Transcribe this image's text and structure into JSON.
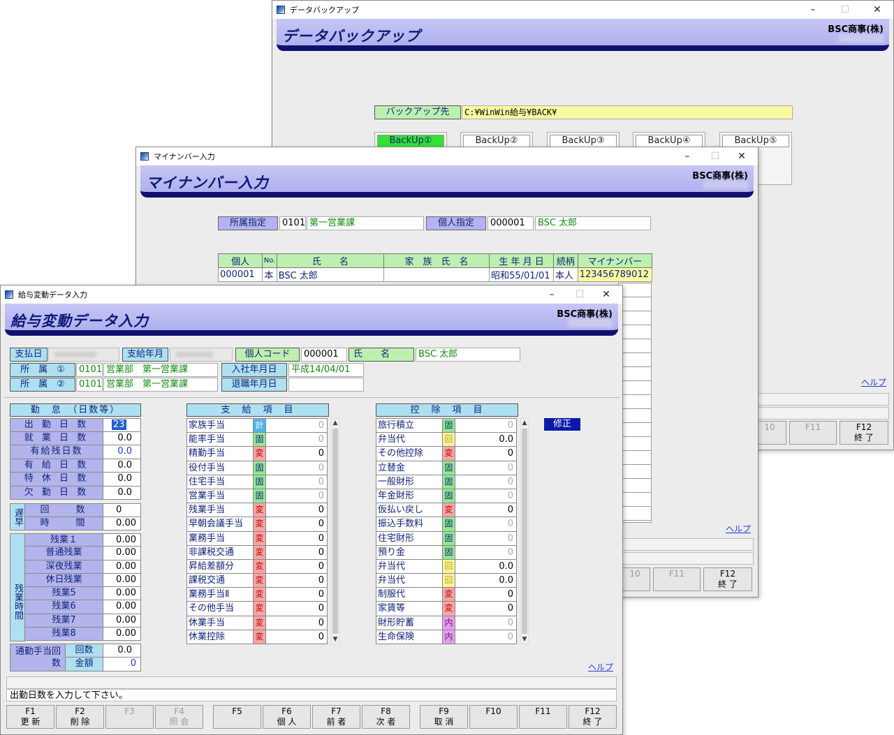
{
  "backup_window": {
    "caption": "データバックアップ",
    "banner_title": "データバックアップ",
    "company": "BSC商事(株)",
    "dest_label": "バックアップ先",
    "dest_path": "C:¥WinWin給与¥BACK¥",
    "buttons": [
      "BackUp①",
      "BackUp②",
      "BackUp③",
      "BackUp④",
      "BackUp⑤"
    ],
    "help": "ヘルプ",
    "fkeys": [
      {
        "key": "10",
        "sub": ""
      },
      {
        "key": "F11",
        "sub": ""
      },
      {
        "key": "F12",
        "sub": "終 了"
      }
    ]
  },
  "mynumber_window": {
    "caption": "マイナンバー入力",
    "banner_title": "マイナンバー入力",
    "company": "BSC商事(株)",
    "dept_label": "所属指定",
    "dept_code": "0101",
    "dept_name": "第一営業課",
    "person_label": "個人指定",
    "person_code": "000001",
    "person_name": "BSC 太郎",
    "columns": [
      "個人",
      "No.",
      "氏　　名",
      "家　族　氏　名",
      "生 年 月 日",
      "続柄",
      "マイナンバー"
    ],
    "row": {
      "code": "000001",
      "no": "本",
      "name": "BSC 太郎",
      "family": "",
      "birth": "昭和55/01/01",
      "relation": "本人",
      "number": "123456789012"
    },
    "help": "ヘルプ",
    "fkeys": [
      {
        "key": "10",
        "sub": ""
      },
      {
        "key": "F11",
        "sub": ""
      },
      {
        "key": "F12",
        "sub": "終 了"
      }
    ]
  },
  "salary_window": {
    "caption": "給与変動データ入力",
    "banner_title": "給与変動データ入力",
    "company": "BSC商事(株)",
    "header": {
      "pay_date_label": "支払日",
      "pay_month_label": "支給年月",
      "person_code_label": "個人コード",
      "person_code": "000001",
      "name_label": "氏　　名",
      "name": "BSC 太郎",
      "dept1_label": "所　属　①",
      "dept1_code": "0101",
      "dept1_name": "営業部　第一営業課",
      "dept2_label": "所　属　②",
      "dept2_code": "0101",
      "dept2_name": "営業部　第一営業課",
      "join_label": "入社年月日",
      "join_date": "平成14/04/01",
      "retire_label": "退職年月日",
      "retire_date": ""
    },
    "attendance": {
      "title": "勤　怠　（日数等）",
      "rows": [
        {
          "label": "出 勤 日 数",
          "value": "23"
        },
        {
          "label": "就 業 日 数",
          "value": "0.0"
        },
        {
          "label": "有給残日数",
          "value": "0.0"
        },
        {
          "label": "有 給 日 数",
          "value": "0.0"
        },
        {
          "label": "特 休 日 数",
          "value": "0.0"
        },
        {
          "label": "欠 勤 日 数",
          "value": "0.0"
        }
      ],
      "late_side": "遅早",
      "late_rows": [
        {
          "label": "回　　数",
          "value": "0"
        },
        {
          "label": "時　　間",
          "value": "0.00"
        }
      ],
      "ot_side": "残業時間",
      "ot_rows": [
        {
          "label": "残業１",
          "value": "0.00"
        },
        {
          "label": "普通残業",
          "value": "0.00"
        },
        {
          "label": "深夜残業",
          "value": "0.00"
        },
        {
          "label": "休日残業",
          "value": "0.00"
        },
        {
          "label": "残業5",
          "value": "0.00"
        },
        {
          "label": "残業6",
          "value": "0.00"
        },
        {
          "label": "残業7",
          "value": "0.00"
        },
        {
          "label": "残業8",
          "value": "0.00"
        }
      ],
      "commute_label": "通勤手当回数",
      "commute_rows": [
        {
          "label": "回数",
          "value": "0.0"
        },
        {
          "label": "金額",
          "value": "0"
        }
      ]
    },
    "payments": {
      "title": "支　給　項　目",
      "rows": [
        {
          "name": "家族手当",
          "code": "計",
          "type": "kei",
          "value": "0",
          "gray": true
        },
        {
          "name": "能率手当",
          "code": "固",
          "type": "ko",
          "value": "0",
          "gray": true
        },
        {
          "name": "精勤手当",
          "code": "変",
          "type": "hen",
          "value": "0",
          "gray": false
        },
        {
          "name": "役付手当",
          "code": "固",
          "type": "ko",
          "value": "0",
          "gray": true
        },
        {
          "name": "住宅手当",
          "code": "固",
          "type": "ko",
          "value": "0",
          "gray": true
        },
        {
          "name": "営業手当",
          "code": "固",
          "type": "ko",
          "value": "0",
          "gray": true
        },
        {
          "name": "残業手当",
          "code": "変",
          "type": "hen",
          "value": "0",
          "gray": false
        },
        {
          "name": "早朝会議手当",
          "code": "変",
          "type": "hen",
          "value": "0",
          "gray": false
        },
        {
          "name": "業務手当",
          "code": "変",
          "type": "hen",
          "value": "0",
          "gray": false
        },
        {
          "name": "非課税交通",
          "code": "変",
          "type": "hen",
          "value": "0",
          "gray": false
        },
        {
          "name": "昇給差額分",
          "code": "変",
          "type": "hen",
          "value": "0",
          "gray": false
        },
        {
          "name": "課税交通",
          "code": "変",
          "type": "hen",
          "value": "0",
          "gray": false
        },
        {
          "name": "業務手当Ⅱ",
          "code": "変",
          "type": "hen",
          "value": "0",
          "gray": false
        },
        {
          "name": "その他手当",
          "code": "変",
          "type": "hen",
          "value": "0",
          "gray": false
        },
        {
          "name": "休業手当",
          "code": "変",
          "type": "hen",
          "value": "0",
          "gray": false
        },
        {
          "name": "休業控除",
          "code": "変",
          "type": "hen",
          "value": "0",
          "gray": false
        }
      ]
    },
    "deductions": {
      "title": "控　除　項　目",
      "rows": [
        {
          "name": "旅行積立",
          "code": "固",
          "type": "ko",
          "value": "0",
          "gray": true
        },
        {
          "name": "弁当代",
          "code": "回",
          "type": "kai",
          "value": "0.0",
          "gray": false
        },
        {
          "name": "その他控除",
          "code": "変",
          "type": "hen",
          "value": "0",
          "gray": false
        },
        {
          "name": "立替金",
          "code": "固",
          "type": "ko",
          "value": "0",
          "gray": true
        },
        {
          "name": "一般財形",
          "code": "固",
          "type": "ko",
          "value": "0",
          "gray": true
        },
        {
          "name": "年金財形",
          "code": "固",
          "type": "ko",
          "value": "0",
          "gray": true
        },
        {
          "name": "仮払い戻し",
          "code": "変",
          "type": "hen",
          "value": "0",
          "gray": false
        },
        {
          "name": "振込手数料",
          "code": "固",
          "type": "ko",
          "value": "0",
          "gray": true
        },
        {
          "name": "住宅財形",
          "code": "固",
          "type": "ko",
          "value": "0",
          "gray": true
        },
        {
          "name": "預り金",
          "code": "固",
          "type": "ko",
          "value": "0",
          "gray": true
        },
        {
          "name": "弁当代",
          "code": "回",
          "type": "kai",
          "value": "0.0",
          "gray": false
        },
        {
          "name": "弁当代",
          "code": "回",
          "type": "kai",
          "value": "0.0",
          "gray": false
        },
        {
          "name": "制服代",
          "code": "変",
          "type": "hen",
          "value": "0",
          "gray": false
        },
        {
          "name": "家賃等",
          "code": "変",
          "type": "hen",
          "value": "0",
          "gray": false
        },
        {
          "name": "財形貯蓄",
          "code": "内",
          "type": "nai",
          "value": "0",
          "gray": true
        },
        {
          "name": "生命保険",
          "code": "内",
          "type": "nai",
          "value": "0",
          "gray": true
        }
      ]
    },
    "mode_badge": "修正",
    "help": "ヘルプ",
    "status_message": "出勤日数を入力して下さい。",
    "fkeys": [
      {
        "key": "F1",
        "sub": "更 新",
        "disabled": false
      },
      {
        "key": "F2",
        "sub": "削 除",
        "disabled": false
      },
      {
        "key": "F3",
        "sub": "",
        "disabled": true
      },
      {
        "key": "F4",
        "sub": "照 会",
        "disabled": true
      },
      {
        "key": "F5",
        "sub": "",
        "disabled": false
      },
      {
        "key": "F6",
        "sub": "個 人",
        "disabled": false
      },
      {
        "key": "F7",
        "sub": "前 者",
        "disabled": false
      },
      {
        "key": "F8",
        "sub": "次 者",
        "disabled": false
      },
      {
        "key": "F9",
        "sub": "取 消",
        "disabled": false
      },
      {
        "key": "F10",
        "sub": "",
        "disabled": false
      },
      {
        "key": "F11",
        "sub": "",
        "disabled": false
      },
      {
        "key": "F12",
        "sub": "終 了",
        "disabled": false
      }
    ]
  },
  "window_controls": {
    "minimize": "–",
    "maximize": "☐",
    "close": "✕"
  }
}
